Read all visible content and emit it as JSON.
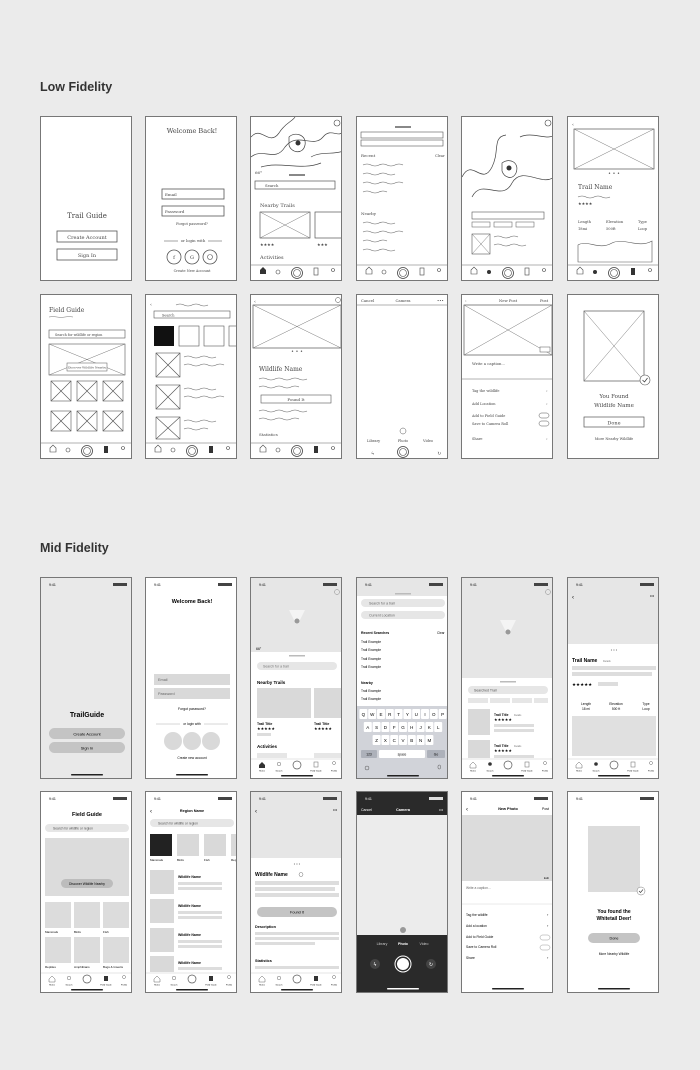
{
  "sections": {
    "low": "Low Fidelity",
    "mid": "Mid Fidelity"
  },
  "lo": {
    "trail_guide": "Trail Guide",
    "create_account": "Create Account",
    "sign_in": "Sign In",
    "welcome": "Welcome Back!",
    "email": "Email",
    "password": "Password",
    "forgot": "Forgot password?",
    "or_login": "or login with",
    "create_new": "Create New Account",
    "search": "Search",
    "nearby_trails": "Nearby Trails",
    "activities": "Activities",
    "recent": "Recent",
    "clear": "Clear",
    "nearby": "Nearby",
    "trail_name": "Trail Name",
    "length": "Length",
    "length_val": "18mi",
    "elevation": "Elevation",
    "elevation_val": "500ft",
    "type": "Type",
    "type_val": "Loop",
    "field_guide": "Field Guide",
    "search_wildlife": "Search for wildlife or region",
    "discover": "Discover Wildlife Nearby",
    "wildlife_name": "Wildlife Name",
    "found_it": "Found It",
    "statistics": "Statistics",
    "cancel": "Cancel",
    "camera": "Camera",
    "library": "Library",
    "photo": "Photo",
    "video": "Video",
    "new_post": "New Post",
    "post": "Post",
    "write_caption": "Write a caption...",
    "tag_wildlife": "Tag the wildlife",
    "add_location": "Add Location",
    "add_field_guide": "Add to Field Guide",
    "save_camera_roll": "Save to Camera Roll",
    "share": "Share",
    "you_found": "You Found",
    "wildlife_name2": "Wildlife Name",
    "done": "Done",
    "more_nearby": "More Nearby Wildlife"
  },
  "mid": {
    "time": "9:41",
    "trailguide": "TrailGuide",
    "create_account": "Create Account",
    "sign_in": "Sign In",
    "welcome": "Welcome Back!",
    "email": "Email",
    "password": "Password",
    "forgot": "Forgot password?",
    "or_login": "or login with",
    "create_new": "Create new account",
    "search_trail": "Search for a trail",
    "nearby_trails": "Nearby Trails",
    "trail_title": "Trail Title",
    "activities": "Activities",
    "current_location": "Current Location",
    "recent_searches": "Recent Searches",
    "clear": "Clear",
    "trail_example": "Trail Example",
    "nearby": "Nearby",
    "kb_row1": [
      "Q",
      "W",
      "E",
      "R",
      "T",
      "Y",
      "U",
      "I",
      "O",
      "P"
    ],
    "kb_row2": [
      "A",
      "S",
      "D",
      "F",
      "G",
      "H",
      "J",
      "K",
      "L"
    ],
    "kb_row3": [
      "Z",
      "X",
      "C",
      "V",
      "B",
      "N",
      "M"
    ],
    "kb_123": "123",
    "kb_space": "space",
    "kb_go": "Go",
    "searched_trail": "Searched Trail",
    "details": "Details",
    "trail_name": "Trail Name",
    "length": "Length",
    "length_val": "18 mi",
    "elevation": "Elevation",
    "elevation_val": "500 ft",
    "type": "Type",
    "type_val": "Loop",
    "field_guide": "Field Guide",
    "search_wildlife": "Search for wildlife or region",
    "discover": "Discover Wildlife Nearby",
    "categories": [
      "Mammals",
      "Birds",
      "Fish",
      "Reptiles",
      "Amphibians",
      "Bugs & Insects"
    ],
    "region_name": "Region Name",
    "cat_strip": [
      "Mammals",
      "Birds",
      "Fish",
      "Rep"
    ],
    "wildlife_name": "Wildlife Name",
    "found_it": "Found It",
    "description": "Description",
    "statistics": "Statistics",
    "cancel": "Cancel",
    "camera": "Camera",
    "library": "Library",
    "photo": "Photo",
    "video": "Video",
    "new_photo": "New Photo",
    "post": "Post",
    "edit": "Edit",
    "write_caption": "Write a caption...",
    "tag_wildlife": "Tag the wildlife",
    "add_location": "Add a location",
    "add_field_guide": "Add to Field Guide",
    "save_camera_roll": "Save to Camera Roll",
    "share": "Share",
    "you_found": "You found the",
    "whitetail": "Whitetail Deer!",
    "done": "Done",
    "more_nearby": "More Nearby Wildlife",
    "tabs": [
      "Home",
      "Search",
      "",
      "Field Guide",
      "Profile"
    ]
  }
}
